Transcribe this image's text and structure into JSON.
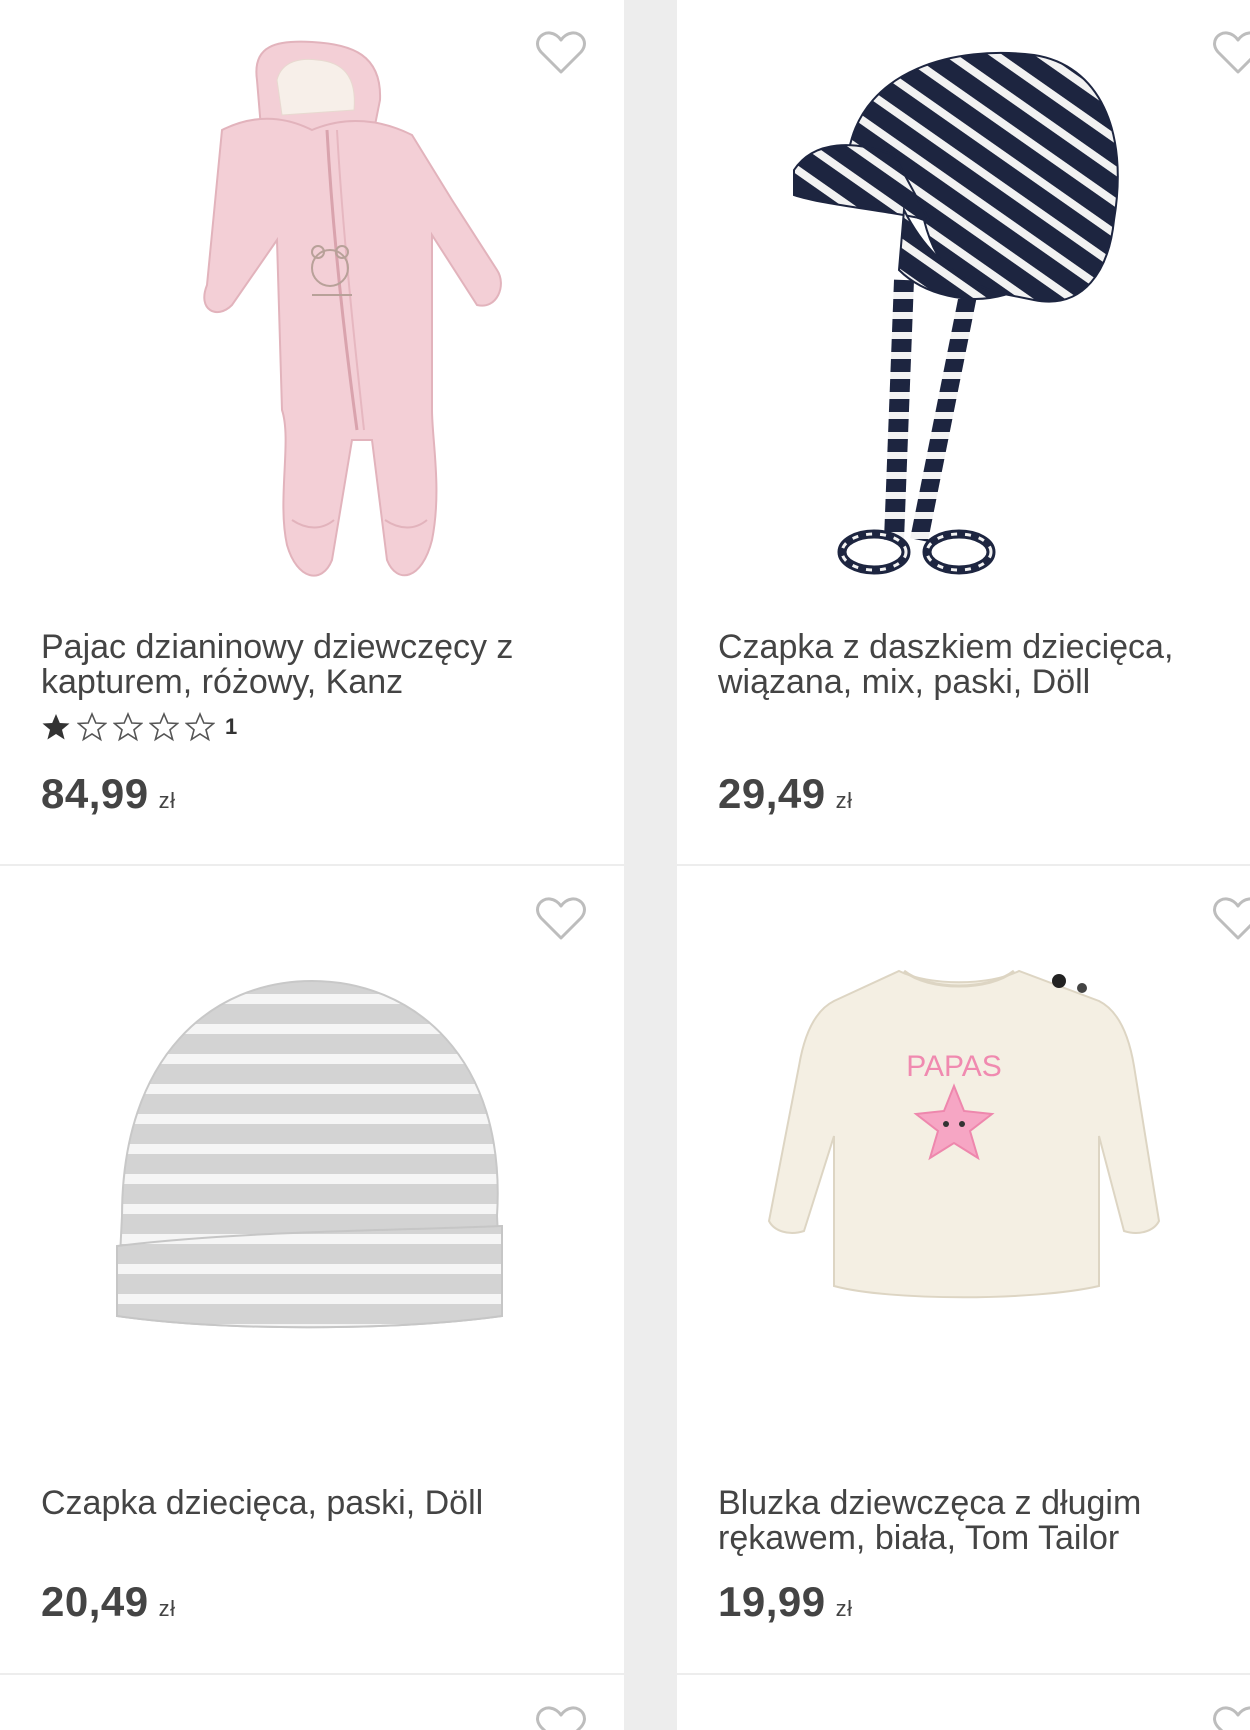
{
  "currency": "zł",
  "products": [
    {
      "title": "Pajac dzianinowy dziewczęcy z kapturem, różowy, Kanz",
      "price": "84,99",
      "rating": 1,
      "rating_max": 5,
      "review_count": "1",
      "image": "pink-snowsuit"
    },
    {
      "title": "Czapka z daszkiem dziecięca, wiązana, mix, paski, Döll",
      "price": "29,49",
      "image": "striped-cap-navy"
    },
    {
      "title": "Czapka dziecięca, paski, Döll",
      "price": "20,49",
      "image": "striped-beanie-grey"
    },
    {
      "title": "Bluzka dziewczęca z długim rękawem, biała, Tom Tailor",
      "price": "19,99",
      "image": "cream-longsleeve-top",
      "print_text": "PAPAS"
    }
  ],
  "icons": {
    "favorite": "heart-outline-icon",
    "star_full": "star-filled-icon",
    "star_empty": "star-outline-icon"
  },
  "colors": {
    "background": "#ededed",
    "card": "#ffffff",
    "text": "#444444",
    "heart": "#bdbdbd",
    "pink": "#f1cbd2",
    "navy": "#1d2540",
    "grey_stripe": "#cfcfcf",
    "cream": "#f4efe3"
  }
}
